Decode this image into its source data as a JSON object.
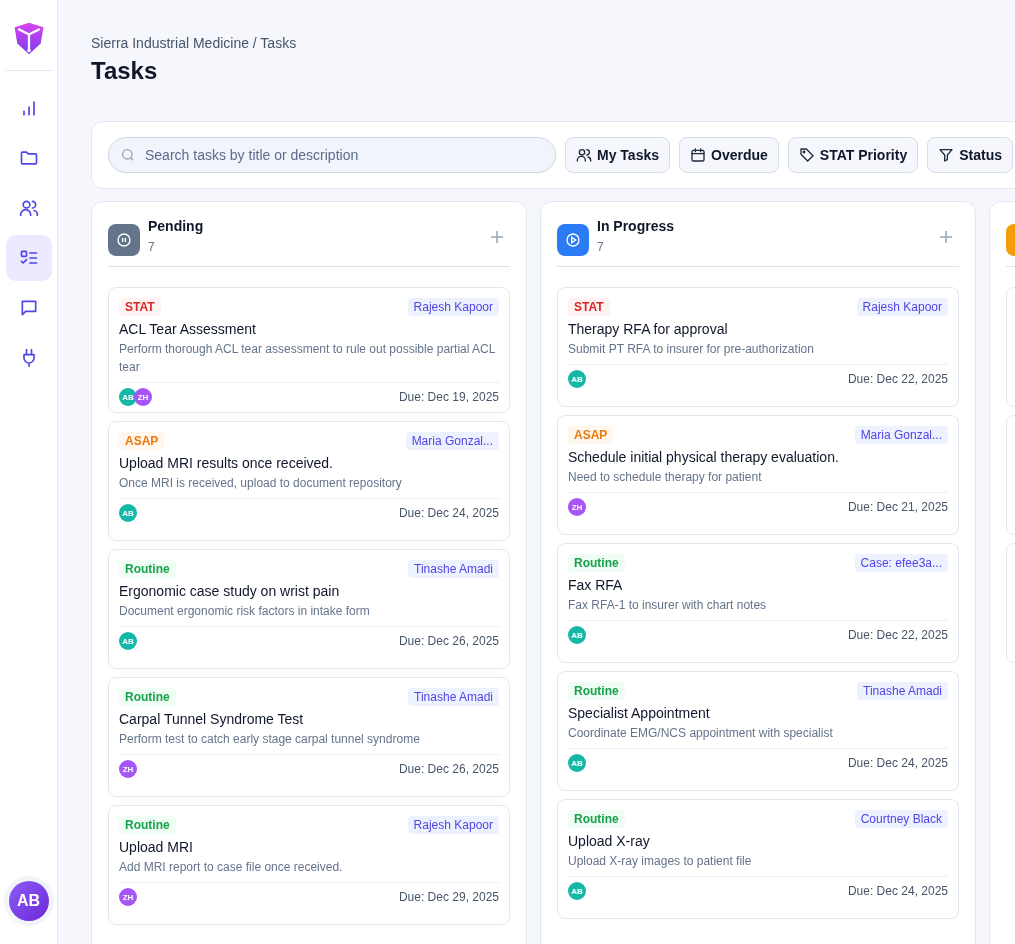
{
  "sidebar": {
    "items": [
      {
        "selected": false
      },
      {
        "selected": false
      },
      {
        "selected": false
      },
      {
        "selected": true
      },
      {
        "selected": false
      },
      {
        "selected": false
      }
    ],
    "user_avatar": "AB"
  },
  "header": {
    "breadcrumb": "Sierra Industrial Medicine / Tasks",
    "title": "Tasks"
  },
  "toolbar": {
    "search": {
      "placeholder": "Search tasks by title or description"
    },
    "filters": [
      {
        "label": "My Tasks"
      },
      {
        "label": "Overdue"
      },
      {
        "label": "STAT Priority"
      },
      {
        "label": "Status"
      }
    ]
  },
  "columns": [
    {
      "title": "Pending",
      "count": "7",
      "kind": "pending",
      "cards": [
        {
          "priority": "STAT",
          "kind": "stat",
          "assignee": "Rajesh Kapoor",
          "title": "ACL Tear Assessment",
          "description": "Perform thorough ACL tear assessment to rule out possible partial ACL tear",
          "avatars": [
            {
              "initials": "AB",
              "color": "#14b8a6"
            },
            {
              "initials": "ZH",
              "color": "#a855f7"
            }
          ],
          "due": "Due: Dec 19, 2025"
        },
        {
          "priority": "ASAP",
          "kind": "asap",
          "assignee": "Maria Gonzal...",
          "title": "Upload MRI results once received.",
          "description": "Once MRI is received, upload to document repository",
          "avatars": [
            {
              "initials": "AB",
              "color": "#14b8a6"
            }
          ],
          "due": "Due: Dec 24, 2025"
        },
        {
          "priority": "Routine",
          "kind": "routine",
          "assignee": "Tinashe Amadi",
          "title": "Ergonomic case study on wrist pain",
          "description": "Document ergonomic risk factors in intake form",
          "avatars": [
            {
              "initials": "AB",
              "color": "#14b8a6"
            }
          ],
          "due": "Due: Dec 26, 2025"
        },
        {
          "priority": "Routine",
          "kind": "routine",
          "assignee": "Tinashe Amadi",
          "title": "Carpal Tunnel Syndrome Test",
          "description": "Perform test to catch early stage carpal tunnel syndrome",
          "avatars": [
            {
              "initials": "ZH",
              "color": "#a855f7"
            }
          ],
          "due": "Due: Dec 26, 2025"
        },
        {
          "priority": "Routine",
          "kind": "routine",
          "assignee": "Rajesh Kapoor",
          "title": "Upload MRI",
          "description": "Add MRI report to case file once received.",
          "avatars": [
            {
              "initials": "ZH",
              "color": "#a855f7"
            }
          ],
          "due": "Due: Dec 29, 2025"
        }
      ]
    },
    {
      "title": "In Progress",
      "count": "7",
      "kind": "progress",
      "cards": [
        {
          "priority": "STAT",
          "kind": "stat",
          "assignee": "Rajesh Kapoor",
          "title": "Therapy RFA for approval",
          "description": "Submit PT RFA to insurer for pre-authorization",
          "avatars": [
            {
              "initials": "AB",
              "color": "#14b8a6"
            }
          ],
          "due": "Due: Dec 22, 2025"
        },
        {
          "priority": "ASAP",
          "kind": "asap",
          "assignee": "Maria Gonzal...",
          "title": "Schedule initial physical therapy evaluation.",
          "description": "Need to schedule therapy for patient",
          "avatars": [
            {
              "initials": "ZH",
              "color": "#a855f7"
            }
          ],
          "due": "Due: Dec 21, 2025"
        },
        {
          "priority": "Routine",
          "kind": "routine",
          "assignee": "Case: efee3a...",
          "title": "Fax RFA",
          "description": "Fax RFA-1 to insurer with chart notes",
          "avatars": [
            {
              "initials": "AB",
              "color": "#14b8a6"
            }
          ],
          "due": "Due: Dec 22, 2025"
        },
        {
          "priority": "Routine",
          "kind": "routine",
          "assignee": "Tinashe Amadi",
          "title": "Specialist Appointment",
          "description": "Coordinate EMG/NCS appointment with specialist",
          "avatars": [
            {
              "initials": "AB",
              "color": "#14b8a6"
            }
          ],
          "due": "Due: Dec 24, 2025"
        },
        {
          "priority": "Routine",
          "kind": "routine",
          "assignee": "Courtney Black",
          "title": "Upload X-ray",
          "description": "Upload X-ray images to patient file",
          "avatars": [
            {
              "initials": "AB",
              "color": "#14b8a6"
            }
          ],
          "due": "Due: Dec 24, 2025"
        }
      ]
    },
    {
      "kind": "review"
    }
  ]
}
